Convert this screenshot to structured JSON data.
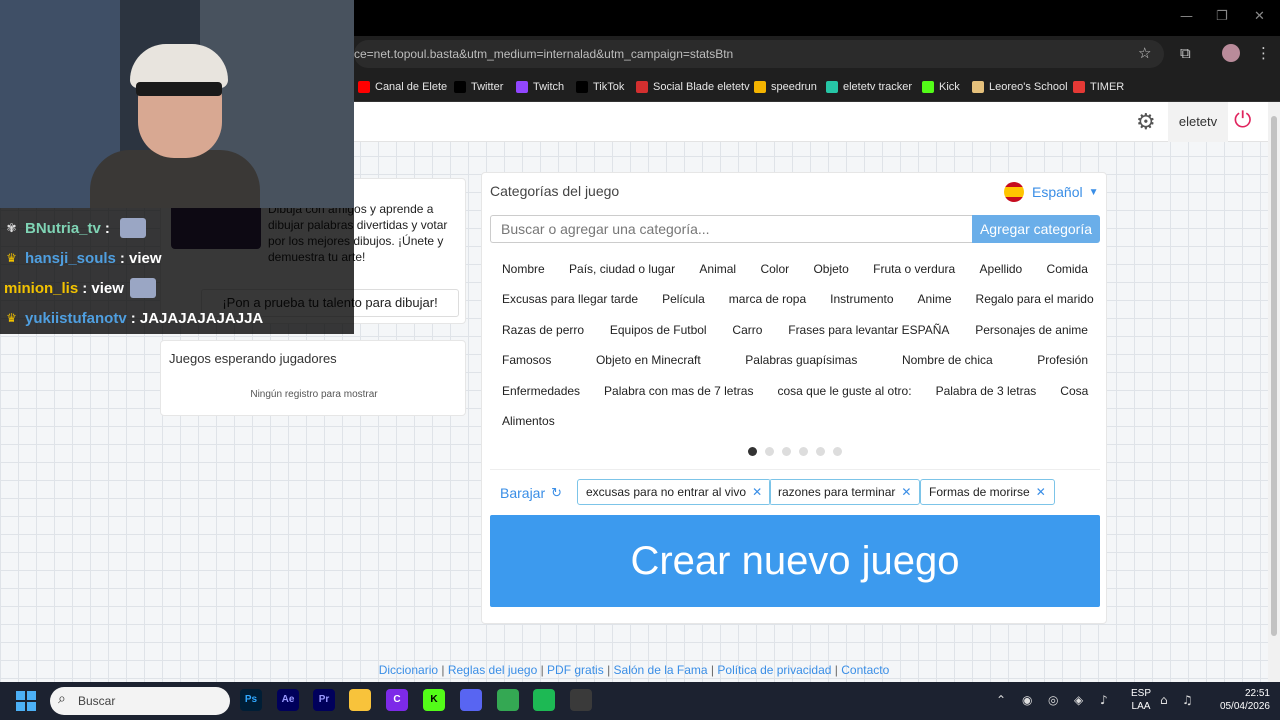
{
  "browser": {
    "url": "ce=net.topoul.basta&utm_medium=internalad&utm_campaign=statsBtn",
    "bookmarks": [
      {
        "label": "Canal de Elete",
        "icon": "youtube-icon",
        "color": "#ff0000"
      },
      {
        "label": "Twitter",
        "icon": "x-icon",
        "color": "#000000"
      },
      {
        "label": "Twitch",
        "icon": "twitch-icon",
        "color": "#9146ff"
      },
      {
        "label": "TikTok",
        "icon": "tiktok-icon",
        "color": "#000000"
      },
      {
        "label": "Social Blade eletetv",
        "icon": "socialblade-icon",
        "color": "#d32f2f"
      },
      {
        "label": "speedrun",
        "icon": "speedrun-icon",
        "color": "#f4b400"
      },
      {
        "label": "eletetv tracker",
        "icon": "tracker-icon",
        "color": "#26c6a6"
      },
      {
        "label": "Kick",
        "icon": "kick-icon",
        "color": "#53fc18"
      },
      {
        "label": "Leoreo's School",
        "icon": "school-icon",
        "color": "#e5c07b"
      },
      {
        "label": "TIMER",
        "icon": "timer-icon",
        "color": "#e53935"
      }
    ]
  },
  "header": {
    "username": "eletetv"
  },
  "promo": {
    "text": "Dibuja con amigos y aprende a dibujar palabras divertidas y votar por los mejores dibujos. ¡Únete y demuestra tu arte!",
    "button": "¡Pon a prueba tu talento para dibujar!"
  },
  "waiting": {
    "title": "Juegos esperando jugadores",
    "empty": "Ningún registro para mostrar"
  },
  "categories": {
    "title": "Categorías del juego",
    "language": "Español",
    "search_placeholder": "Buscar o agregar una categoría...",
    "add_button": "Agregar categoría",
    "rows": [
      [
        "Nombre",
        "País, ciudad o lugar",
        "Animal",
        "Color",
        "Objeto",
        "Fruta o verdura",
        "Apellido",
        "Comida"
      ],
      [
        "Excusas para llegar tarde",
        "Película",
        "marca de ropa",
        "Instrumento",
        "Anime",
        "Regalo para el marido"
      ],
      [
        "Razas de perro",
        "Equipos de Futbol",
        "Carro",
        "Frases para levantar ESPAÑA",
        "Personajes de anime"
      ],
      [
        "Famosos",
        "Objeto en Minecraft",
        "Palabras guapísimas",
        "Nombre de chica",
        "Profesión"
      ],
      [
        "Enfermedades",
        "Palabra con mas de 7 letras",
        "cosa que le guste al otro:",
        "Palabra de 3 letras",
        "Cosa"
      ],
      [
        "Alimentos"
      ]
    ],
    "page_count": 6,
    "active_page": 1,
    "shuffle": "Barajar",
    "selected": [
      "excusas para no entrar al vivo",
      "razones para terminar",
      "Formas de morirse"
    ],
    "create_button": "Crear nuevo juego"
  },
  "footer": {
    "links": [
      "Diccionario",
      "Reglas del juego",
      "PDF gratis",
      "Salón de la Fama",
      "Política de privacidad",
      "Contacto"
    ]
  },
  "chat": [
    {
      "user": "BNutria_tv",
      "message": "",
      "color": "#7fd3b4",
      "badge": "paw-icon",
      "emote": true
    },
    {
      "user": "hansji_souls",
      "message": "view",
      "color": "#4f9fe0",
      "badge": "crown-icon",
      "emote": false
    },
    {
      "user": "minion_lis",
      "message": "view",
      "color": "#f2c200",
      "badge": "",
      "emote": true
    },
    {
      "user": "yukiistufanotv",
      "message": "JAJAJAJAJAJJA",
      "color": "#4f9fe0",
      "badge": "crown-icon",
      "emote": false
    }
  ],
  "taskbar": {
    "search_placeholder": "Buscar",
    "apps": [
      {
        "name": "photoshop-icon",
        "label": "Ps",
        "bg": "#001e36",
        "fg": "#31a8ff"
      },
      {
        "name": "after-effects-icon",
        "label": "Ae",
        "bg": "#00005b",
        "fg": "#9999ff"
      },
      {
        "name": "premiere-icon",
        "label": "Pr",
        "bg": "#00005b",
        "fg": "#9999ff"
      },
      {
        "name": "file-explorer-icon",
        "label": "",
        "bg": "#f8c33b",
        "fg": "#000000"
      },
      {
        "name": "canva-icon",
        "label": "C",
        "bg": "#7d2ae8",
        "fg": "#ffffff"
      },
      {
        "name": "kick-app-icon",
        "label": "K",
        "bg": "#53fc18",
        "fg": "#000000"
      },
      {
        "name": "discord-icon",
        "label": "",
        "bg": "#5865f2",
        "fg": "#ffffff"
      },
      {
        "name": "chrome-icon",
        "label": "",
        "bg": "#34a853",
        "fg": "#ffffff"
      },
      {
        "name": "spotify-icon",
        "label": "",
        "bg": "#1db954",
        "fg": "#000000"
      },
      {
        "name": "obs-icon",
        "label": "",
        "bg": "#3a3a3a",
        "fg": "#ffffff"
      }
    ],
    "lang_line1": "ESP",
    "lang_line2": "LAA",
    "time": "22:51",
    "date": "05/04/2026"
  }
}
